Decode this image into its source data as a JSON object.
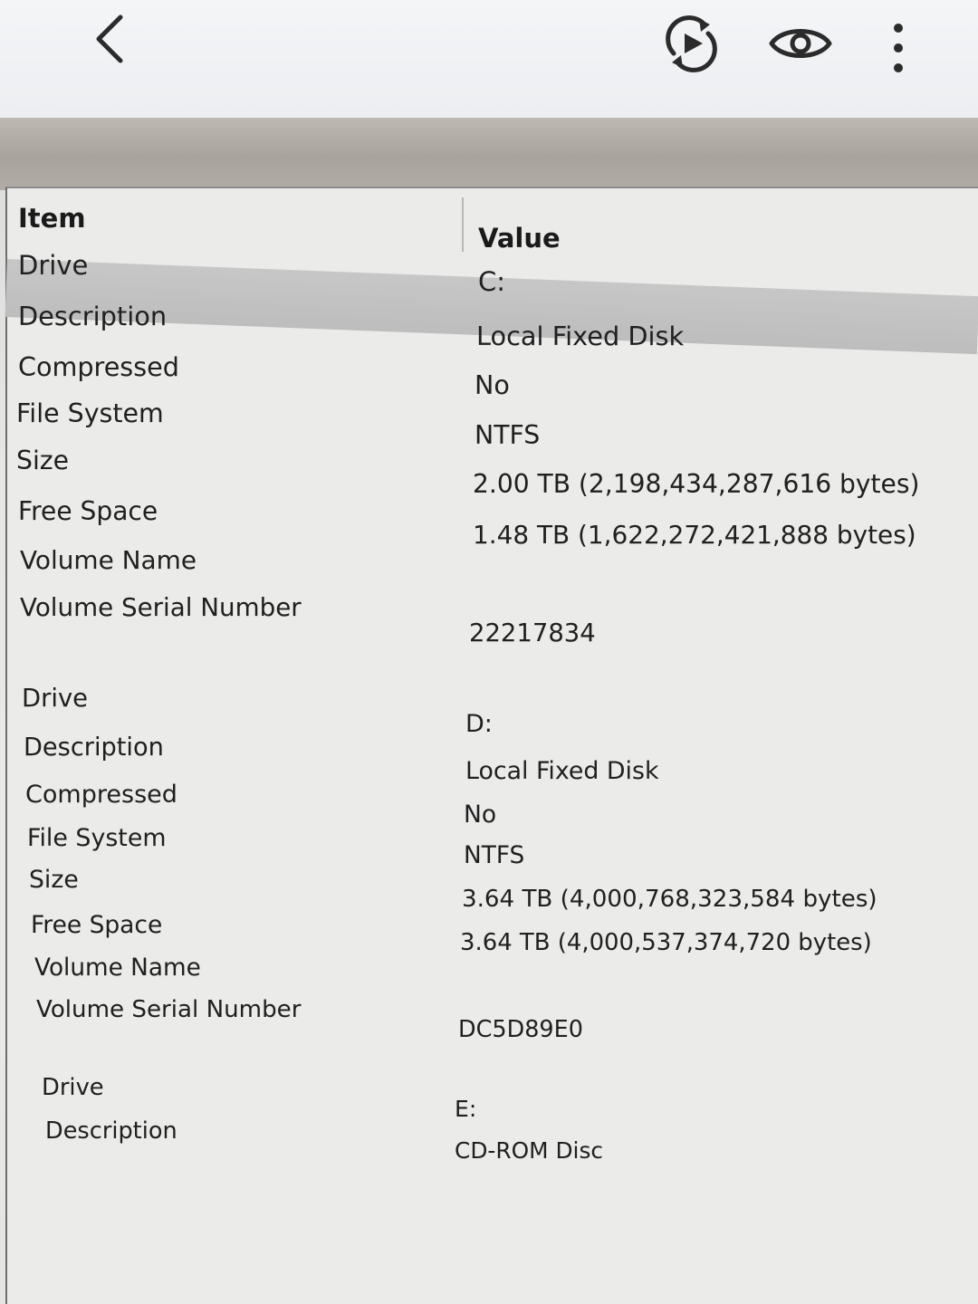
{
  "viewer": {
    "back_icon": "chevron-left-icon",
    "motion_icon": "motion-photo-play-icon",
    "eye_icon": "eye-icon",
    "more_icon": "more-vertical-icon"
  },
  "table": {
    "columns": {
      "item": "Item",
      "value": "Value"
    },
    "rows": [
      {
        "item": "Drive",
        "value": "C:"
      },
      {
        "item": "Description",
        "value": "Local Fixed Disk"
      },
      {
        "item": "Compressed",
        "value": "No"
      },
      {
        "item": "File System",
        "value": "NTFS"
      },
      {
        "item": "Size",
        "value": "2.00 TB (2,198,434,287,616 bytes)"
      },
      {
        "item": "Free Space",
        "value": "1.48 TB (1,622,272,421,888 bytes)"
      },
      {
        "item": "Volume Name",
        "value": ""
      },
      {
        "item": "Volume Serial Number",
        "value": "22217834"
      },
      {
        "item": "",
        "value": ""
      },
      {
        "item": "Drive",
        "value": "D:"
      },
      {
        "item": "Description",
        "value": "Local Fixed Disk"
      },
      {
        "item": "Compressed",
        "value": "No"
      },
      {
        "item": "File System",
        "value": "NTFS"
      },
      {
        "item": "Size",
        "value": "3.64 TB (4,000,768,323,584 bytes)"
      },
      {
        "item": "Free Space",
        "value": "3.64 TB (4,000,537,374,720 bytes)"
      },
      {
        "item": "Volume Name",
        "value": ""
      },
      {
        "item": "Volume Serial Number",
        "value": "DC5D89E0"
      },
      {
        "item": "",
        "value": ""
      },
      {
        "item": "Drive",
        "value": "E:"
      },
      {
        "item": "Description",
        "value": "CD-ROM Disc"
      }
    ]
  }
}
